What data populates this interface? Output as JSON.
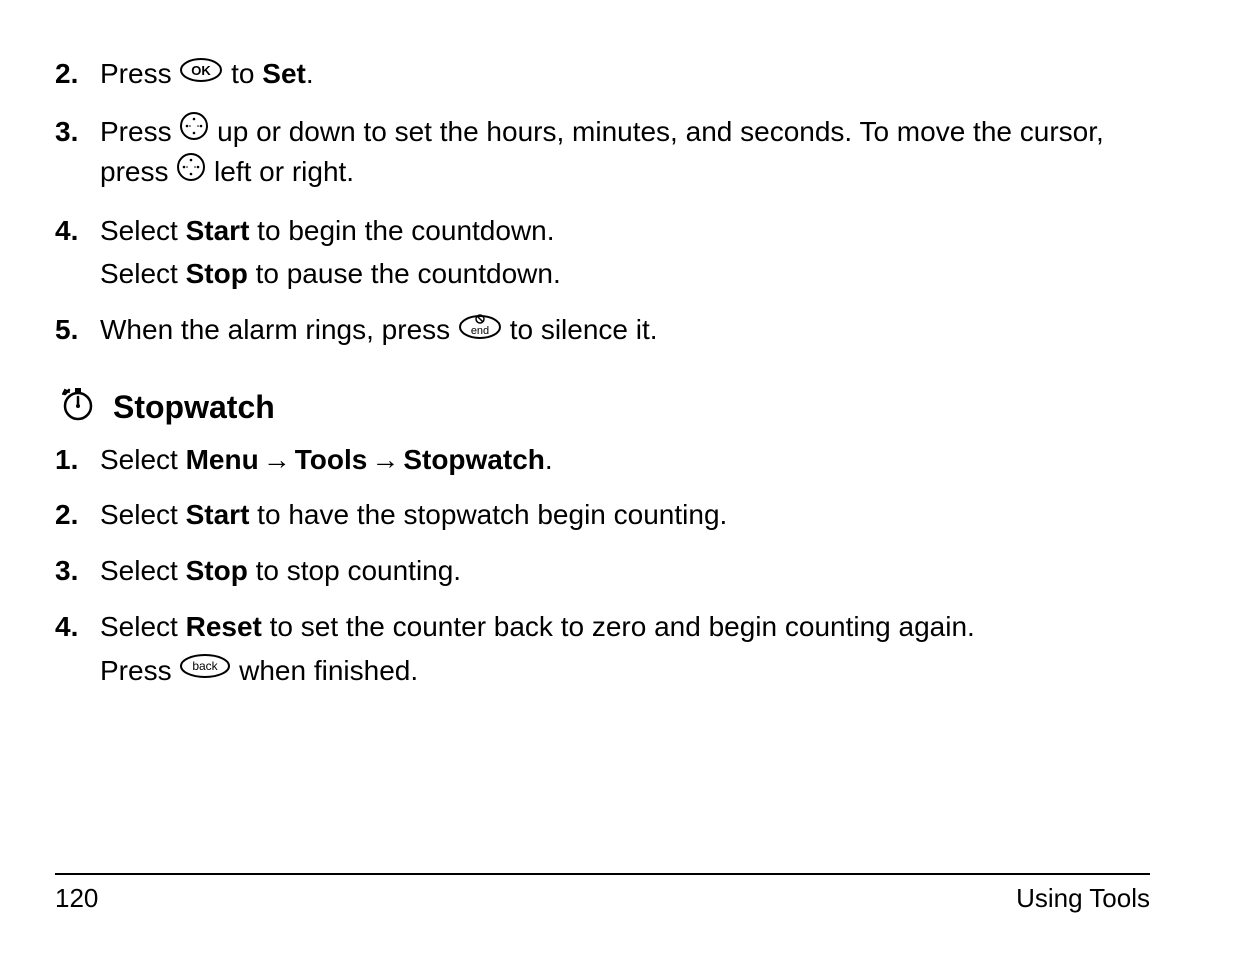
{
  "list1": {
    "items": [
      {
        "num": "2.",
        "parts": [
          {
            "t": "text",
            "v": "Press "
          },
          {
            "t": "icon",
            "v": "ok"
          },
          {
            "t": "text",
            "v": " to "
          },
          {
            "t": "bold",
            "v": "Set"
          },
          {
            "t": "text",
            "v": "."
          }
        ]
      },
      {
        "num": "3.",
        "parts": [
          {
            "t": "text",
            "v": "Press  "
          },
          {
            "t": "icon",
            "v": "nav"
          },
          {
            "t": "text",
            "v": " up or down to set the hours, minutes, and seconds. To move the cursor, press  "
          },
          {
            "t": "icon",
            "v": "nav"
          },
          {
            "t": "text",
            "v": " left or right."
          }
        ]
      },
      {
        "num": "4.",
        "lines": [
          [
            {
              "t": "text",
              "v": "Select "
            },
            {
              "t": "bold",
              "v": "Start"
            },
            {
              "t": "text",
              "v": " to begin the countdown."
            }
          ],
          [
            {
              "t": "text",
              "v": "Select "
            },
            {
              "t": "bold",
              "v": "Stop"
            },
            {
              "t": "text",
              "v": " to pause the countdown."
            }
          ]
        ]
      },
      {
        "num": "5.",
        "parts": [
          {
            "t": "text",
            "v": "When the alarm rings, press  "
          },
          {
            "t": "icon",
            "v": "end"
          },
          {
            "t": "text",
            "v": " to silence it."
          }
        ]
      }
    ]
  },
  "section": {
    "title": "Stopwatch"
  },
  "list2": {
    "items": [
      {
        "num": "1.",
        "parts": [
          {
            "t": "text",
            "v": "Select "
          },
          {
            "t": "bold",
            "v": "Menu"
          },
          {
            "t": "arrow",
            "v": "→"
          },
          {
            "t": "bold",
            "v": "Tools"
          },
          {
            "t": "arrow",
            "v": "→"
          },
          {
            "t": "bold",
            "v": "Stopwatch"
          },
          {
            "t": "text",
            "v": "."
          }
        ]
      },
      {
        "num": "2.",
        "parts": [
          {
            "t": "text",
            "v": "Select "
          },
          {
            "t": "bold",
            "v": "Start"
          },
          {
            "t": "text",
            "v": " to have the stopwatch begin counting."
          }
        ]
      },
      {
        "num": "3.",
        "parts": [
          {
            "t": "text",
            "v": "Select "
          },
          {
            "t": "bold",
            "v": "Stop"
          },
          {
            "t": "text",
            "v": " to stop counting."
          }
        ]
      },
      {
        "num": "4.",
        "lines": [
          [
            {
              "t": "text",
              "v": "Select "
            },
            {
              "t": "bold",
              "v": "Reset"
            },
            {
              "t": "text",
              "v": " to set the counter back to zero and begin counting again."
            }
          ],
          [
            {
              "t": "text",
              "v": "Press "
            },
            {
              "t": "icon",
              "v": "back"
            },
            {
              "t": "text",
              "v": " when finished."
            }
          ]
        ]
      }
    ]
  },
  "footer": {
    "page_number": "120",
    "section_label": "Using Tools"
  }
}
